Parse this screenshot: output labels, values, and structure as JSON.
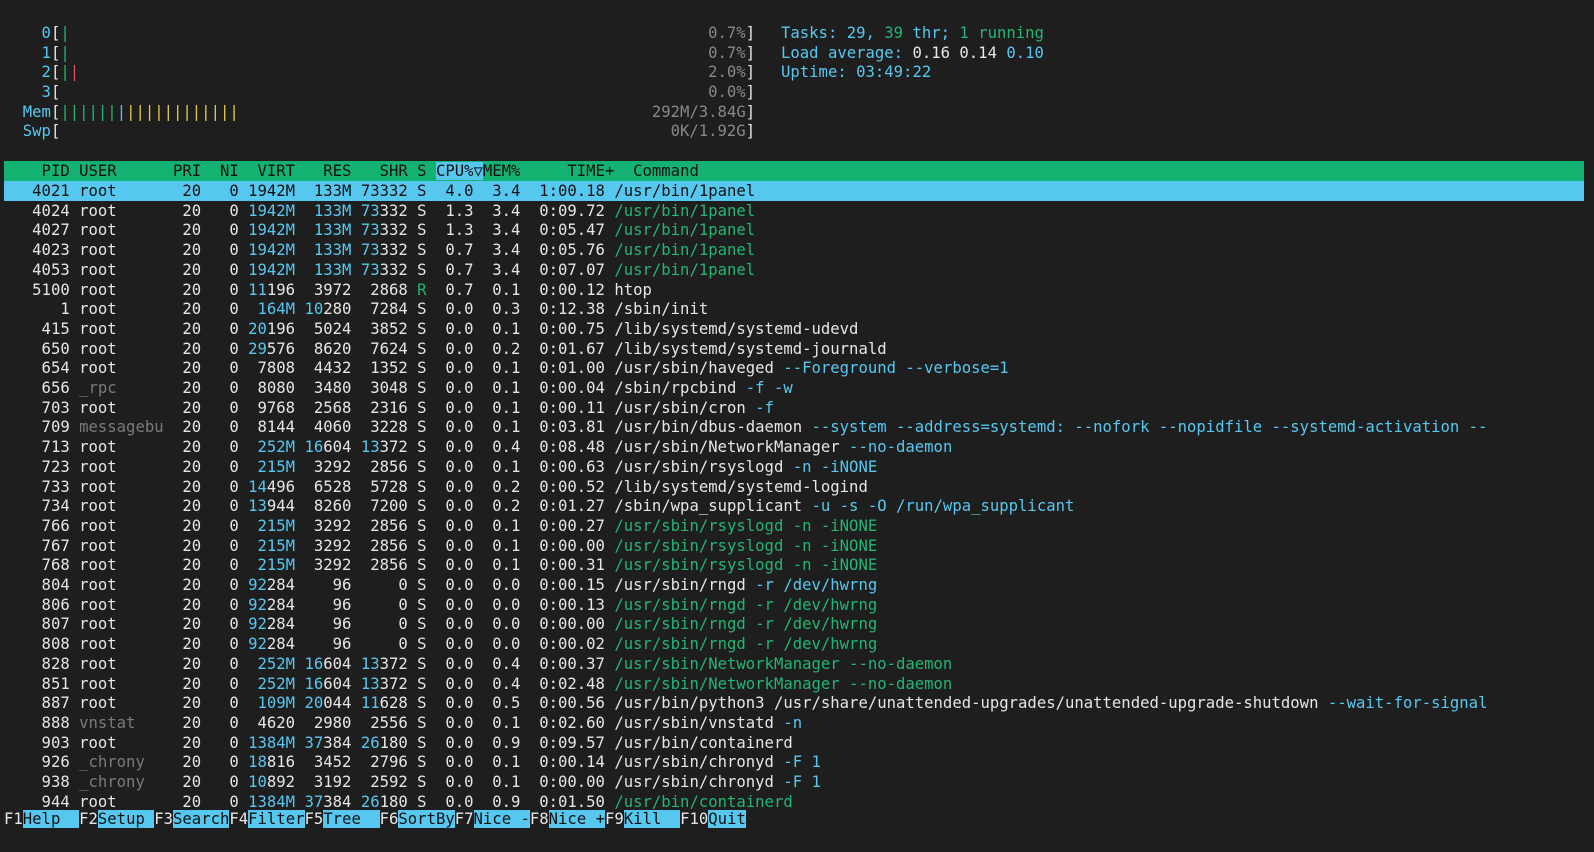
{
  "colors": {
    "background": "#1e1e1e",
    "header_bg": "#13b270",
    "selection_bg": "#56c8f0",
    "cyan": "#56c8f0",
    "green": "#22b574",
    "red": "#e0525c",
    "yellow": "#e6c84a"
  },
  "meters": {
    "cpu": [
      {
        "label": "0",
        "bar_green": "|",
        "bar_red": "",
        "value": "0.7%"
      },
      {
        "label": "1",
        "bar_green": "|",
        "bar_red": "",
        "value": "0.7%"
      },
      {
        "label": "2",
        "bar_green": "|",
        "bar_red": "|",
        "value": "2.0%"
      },
      {
        "label": "3",
        "bar_green": "",
        "bar_red": "",
        "value": "0.0%"
      }
    ],
    "mem": {
      "label": "Mem",
      "bar_green": "||||||",
      "bar_blue": "|",
      "bar_yellow": "||||||||||||",
      "value": "292M/3.84G"
    },
    "swp": {
      "label": "Swp",
      "value": "0K/1.92G"
    }
  },
  "stats": {
    "tasks_label": "Tasks:",
    "tasks_count": "29",
    "threads": "39",
    "thr_label": "thr;",
    "running": "1",
    "running_label": "running",
    "load_label": "Load average:",
    "load1": "0.16",
    "load5": "0.14",
    "load15": "0.10",
    "uptime_label": "Uptime:",
    "uptime": "03:49:22"
  },
  "table": {
    "headers": {
      "pid": "PID",
      "user": "USER",
      "pri": "PRI",
      "ni": "NI",
      "virt": "VIRT",
      "res": "RES",
      "shr": "SHR",
      "s": "S",
      "cpu": "CPU%▽",
      "mem": "MEM%",
      "time": "TIME+",
      "command": "Command"
    },
    "rows": [
      {
        "pid": "4021",
        "user": "root",
        "pri": "20",
        "ni": "0",
        "virt": "1942M",
        "res": "133M",
        "shr": "73332",
        "s": "S",
        "cpu": "4.0",
        "mem": "3.4",
        "time": "1:00.18",
        "cmd": "/usr/bin/1panel",
        "thread": false,
        "selected": true
      },
      {
        "pid": "4024",
        "user": "root",
        "pri": "20",
        "ni": "0",
        "virt": "1942M",
        "res": "133M",
        "shr": "73332",
        "s": "S",
        "cpu": "1.3",
        "mem": "3.4",
        "time": "0:09.72",
        "cmd": "/usr/bin/1panel",
        "thread": true
      },
      {
        "pid": "4027",
        "user": "root",
        "pri": "20",
        "ni": "0",
        "virt": "1942M",
        "res": "133M",
        "shr": "73332",
        "s": "S",
        "cpu": "1.3",
        "mem": "3.4",
        "time": "0:05.47",
        "cmd": "/usr/bin/1panel",
        "thread": true
      },
      {
        "pid": "4023",
        "user": "root",
        "pri": "20",
        "ni": "0",
        "virt": "1942M",
        "res": "133M",
        "shr": "73332",
        "s": "S",
        "cpu": "0.7",
        "mem": "3.4",
        "time": "0:05.76",
        "cmd": "/usr/bin/1panel",
        "thread": true
      },
      {
        "pid": "4053",
        "user": "root",
        "pri": "20",
        "ni": "0",
        "virt": "1942M",
        "res": "133M",
        "shr": "73332",
        "s": "S",
        "cpu": "0.7",
        "mem": "3.4",
        "time": "0:07.07",
        "cmd": "/usr/bin/1panel",
        "thread": true
      },
      {
        "pid": "5100",
        "user": "root",
        "pri": "20",
        "ni": "0",
        "virt": "11196",
        "res": "3972",
        "shr": "2868",
        "s": "R",
        "cpu": "0.7",
        "mem": "0.1",
        "time": "0:00.12",
        "cmd": "htop",
        "thread": false
      },
      {
        "pid": "1",
        "user": "root",
        "pri": "20",
        "ni": "0",
        "virt": "164M",
        "res": "10280",
        "shr": "7284",
        "s": "S",
        "cpu": "0.0",
        "mem": "0.3",
        "time": "0:12.38",
        "cmd": "/sbin/init",
        "thread": false
      },
      {
        "pid": "415",
        "user": "root",
        "pri": "20",
        "ni": "0",
        "virt": "20196",
        "res": "5024",
        "shr": "3852",
        "s": "S",
        "cpu": "0.0",
        "mem": "0.1",
        "time": "0:00.75",
        "cmd": "/lib/systemd/systemd-udevd",
        "thread": false
      },
      {
        "pid": "650",
        "user": "root",
        "pri": "20",
        "ni": "0",
        "virt": "29576",
        "res": "8620",
        "shr": "7624",
        "s": "S",
        "cpu": "0.0",
        "mem": "0.2",
        "time": "0:01.67",
        "cmd": "/lib/systemd/systemd-journald",
        "thread": false
      },
      {
        "pid": "654",
        "user": "root",
        "pri": "20",
        "ni": "0",
        "virt": "7808",
        "res": "4432",
        "shr": "1352",
        "s": "S",
        "cpu": "0.0",
        "mem": "0.1",
        "time": "0:01.00",
        "cmd": "/usr/sbin/haveged",
        "args": " --Foreground --verbose=1",
        "thread": false
      },
      {
        "pid": "656",
        "user": "_rpc",
        "pri": "20",
        "ni": "0",
        "virt": "8080",
        "res": "3480",
        "shr": "3048",
        "s": "S",
        "cpu": "0.0",
        "mem": "0.1",
        "time": "0:00.04",
        "cmd": "/sbin/rpcbind",
        "args": " -f -w",
        "thread": false
      },
      {
        "pid": "703",
        "user": "root",
        "pri": "20",
        "ni": "0",
        "virt": "9768",
        "res": "2568",
        "shr": "2316",
        "s": "S",
        "cpu": "0.0",
        "mem": "0.1",
        "time": "0:00.11",
        "cmd": "/usr/sbin/cron",
        "args": " -f",
        "thread": false
      },
      {
        "pid": "709",
        "user": "messagebu",
        "pri": "20",
        "ni": "0",
        "virt": "8144",
        "res": "4060",
        "shr": "3228",
        "s": "S",
        "cpu": "0.0",
        "mem": "0.1",
        "time": "0:03.81",
        "cmd": "/usr/bin/dbus-daemon",
        "args": " --system --address=systemd: --nofork --nopidfile --systemd-activation --",
        "thread": false
      },
      {
        "pid": "713",
        "user": "root",
        "pri": "20",
        "ni": "0",
        "virt": "252M",
        "res": "16604",
        "shr": "13372",
        "s": "S",
        "cpu": "0.0",
        "mem": "0.4",
        "time": "0:08.48",
        "cmd": "/usr/sbin/NetworkManager",
        "args": " --no-daemon",
        "thread": false
      },
      {
        "pid": "723",
        "user": "root",
        "pri": "20",
        "ni": "0",
        "virt": "215M",
        "res": "3292",
        "shr": "2856",
        "s": "S",
        "cpu": "0.0",
        "mem": "0.1",
        "time": "0:00.63",
        "cmd": "/usr/sbin/rsyslogd",
        "args": " -n -iNONE",
        "thread": false
      },
      {
        "pid": "733",
        "user": "root",
        "pri": "20",
        "ni": "0",
        "virt": "14496",
        "res": "6528",
        "shr": "5728",
        "s": "S",
        "cpu": "0.0",
        "mem": "0.2",
        "time": "0:00.52",
        "cmd": "/lib/systemd/systemd-logind",
        "thread": false
      },
      {
        "pid": "734",
        "user": "root",
        "pri": "20",
        "ni": "0",
        "virt": "13944",
        "res": "8260",
        "shr": "7200",
        "s": "S",
        "cpu": "0.0",
        "mem": "0.2",
        "time": "0:01.27",
        "cmd": "/sbin/wpa_supplicant",
        "args": " -u -s -O /run/wpa_supplicant",
        "thread": false
      },
      {
        "pid": "766",
        "user": "root",
        "pri": "20",
        "ni": "0",
        "virt": "215M",
        "res": "3292",
        "shr": "2856",
        "s": "S",
        "cpu": "0.0",
        "mem": "0.1",
        "time": "0:00.27",
        "cmd": "/usr/sbin/rsyslogd -n -iNONE",
        "thread": true
      },
      {
        "pid": "767",
        "user": "root",
        "pri": "20",
        "ni": "0",
        "virt": "215M",
        "res": "3292",
        "shr": "2856",
        "s": "S",
        "cpu": "0.0",
        "mem": "0.1",
        "time": "0:00.00",
        "cmd": "/usr/sbin/rsyslogd -n -iNONE",
        "thread": true
      },
      {
        "pid": "768",
        "user": "root",
        "pri": "20",
        "ni": "0",
        "virt": "215M",
        "res": "3292",
        "shr": "2856",
        "s": "S",
        "cpu": "0.0",
        "mem": "0.1",
        "time": "0:00.31",
        "cmd": "/usr/sbin/rsyslogd -n -iNONE",
        "thread": true
      },
      {
        "pid": "804",
        "user": "root",
        "pri": "20",
        "ni": "0",
        "virt": "92284",
        "res": "96",
        "shr": "0",
        "s": "S",
        "cpu": "0.0",
        "mem": "0.0",
        "time": "0:00.15",
        "cmd": "/usr/sbin/rngd",
        "args": " -r /dev/hwrng",
        "thread": false
      },
      {
        "pid": "806",
        "user": "root",
        "pri": "20",
        "ni": "0",
        "virt": "92284",
        "res": "96",
        "shr": "0",
        "s": "S",
        "cpu": "0.0",
        "mem": "0.0",
        "time": "0:00.13",
        "cmd": "/usr/sbin/rngd -r /dev/hwrng",
        "thread": true
      },
      {
        "pid": "807",
        "user": "root",
        "pri": "20",
        "ni": "0",
        "virt": "92284",
        "res": "96",
        "shr": "0",
        "s": "S",
        "cpu": "0.0",
        "mem": "0.0",
        "time": "0:00.00",
        "cmd": "/usr/sbin/rngd -r /dev/hwrng",
        "thread": true
      },
      {
        "pid": "808",
        "user": "root",
        "pri": "20",
        "ni": "0",
        "virt": "92284",
        "res": "96",
        "shr": "0",
        "s": "S",
        "cpu": "0.0",
        "mem": "0.0",
        "time": "0:00.02",
        "cmd": "/usr/sbin/rngd -r /dev/hwrng",
        "thread": true
      },
      {
        "pid": "828",
        "user": "root",
        "pri": "20",
        "ni": "0",
        "virt": "252M",
        "res": "16604",
        "shr": "13372",
        "s": "S",
        "cpu": "0.0",
        "mem": "0.4",
        "time": "0:00.37",
        "cmd": "/usr/sbin/NetworkManager --no-daemon",
        "thread": true
      },
      {
        "pid": "851",
        "user": "root",
        "pri": "20",
        "ni": "0",
        "virt": "252M",
        "res": "16604",
        "shr": "13372",
        "s": "S",
        "cpu": "0.0",
        "mem": "0.4",
        "time": "0:02.48",
        "cmd": "/usr/sbin/NetworkManager --no-daemon",
        "thread": true
      },
      {
        "pid": "887",
        "user": "root",
        "pri": "20",
        "ni": "0",
        "virt": "109M",
        "res": "20044",
        "shr": "11628",
        "s": "S",
        "cpu": "0.0",
        "mem": "0.5",
        "time": "0:00.56",
        "cmd": "/usr/bin/python3 /usr/share/unattended-upgrades/unattended-upgrade-shutdown",
        "args": " --wait-for-signal",
        "thread": false
      },
      {
        "pid": "888",
        "user": "vnstat",
        "pri": "20",
        "ni": "0",
        "virt": "4620",
        "res": "2980",
        "shr": "2556",
        "s": "S",
        "cpu": "0.0",
        "mem": "0.1",
        "time": "0:02.60",
        "cmd": "/usr/sbin/vnstatd",
        "args": " -n",
        "thread": false
      },
      {
        "pid": "903",
        "user": "root",
        "pri": "20",
        "ni": "0",
        "virt": "1384M",
        "res": "37384",
        "shr": "26180",
        "s": "S",
        "cpu": "0.0",
        "mem": "0.9",
        "time": "0:09.57",
        "cmd": "/usr/bin/containerd",
        "thread": false
      },
      {
        "pid": "926",
        "user": "_chrony",
        "pri": "20",
        "ni": "0",
        "virt": "18816",
        "res": "3452",
        "shr": "2796",
        "s": "S",
        "cpu": "0.0",
        "mem": "0.1",
        "time": "0:00.14",
        "cmd": "/usr/sbin/chronyd",
        "args": " -F 1",
        "thread": false
      },
      {
        "pid": "938",
        "user": "_chrony",
        "pri": "20",
        "ni": "0",
        "virt": "10892",
        "res": "3192",
        "shr": "2592",
        "s": "S",
        "cpu": "0.0",
        "mem": "0.1",
        "time": "0:00.00",
        "cmd": "/usr/sbin/chronyd",
        "args": " -F 1",
        "thread": false
      },
      {
        "pid": "944",
        "user": "root",
        "pri": "20",
        "ni": "0",
        "virt": "1384M",
        "res": "37384",
        "shr": "26180",
        "s": "S",
        "cpu": "0.0",
        "mem": "0.9",
        "time": "0:01.50",
        "cmd": "/usr/bin/containerd",
        "thread": true
      }
    ]
  },
  "footer": [
    {
      "key": "F1",
      "label": "Help  "
    },
    {
      "key": "F2",
      "label": "Setup "
    },
    {
      "key": "F3",
      "label": "Search"
    },
    {
      "key": "F4",
      "label": "Filter"
    },
    {
      "key": "F5",
      "label": "Tree  "
    },
    {
      "key": "F6",
      "label": "SortBy"
    },
    {
      "key": "F7",
      "label": "Nice -"
    },
    {
      "key": "F8",
      "label": "Nice +"
    },
    {
      "key": "F9",
      "label": "Kill  "
    },
    {
      "key": "F10",
      "label": "Quit"
    }
  ]
}
